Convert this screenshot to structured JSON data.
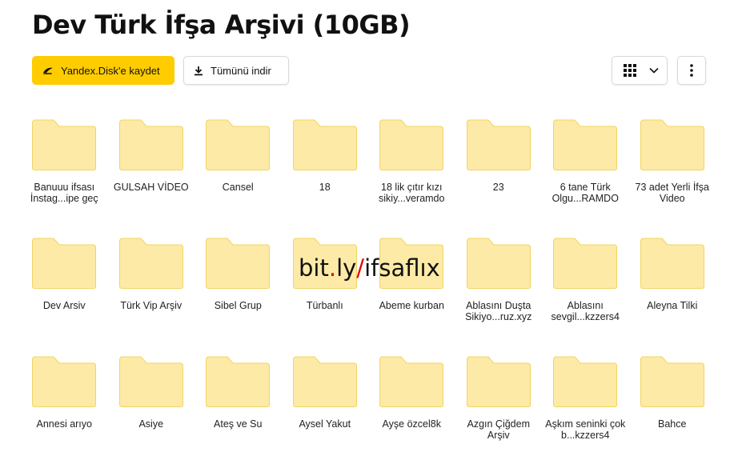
{
  "header": {
    "title": "Dev Türk İfşa Arşivi (10GB)"
  },
  "toolbar": {
    "save_label": "Yandex.Disk'e kaydet",
    "download_label": "Tümünü indir",
    "view_icon": "grid-icon",
    "more_icon": "more-vertical-icon"
  },
  "colors": {
    "accent": "#ffcc00",
    "folder_fill": "#fdeaa6",
    "folder_stroke": "#f2d462"
  },
  "watermark": {
    "part1": "bit",
    "dot": ".",
    "part2": "ly",
    "slash": "/",
    "part3": "ifsaflıx"
  },
  "folders": [
    {
      "name": "Banuuu ifsası İnstag...ipe geç"
    },
    {
      "name": "GULSAH VİDEO"
    },
    {
      "name": "Cansel"
    },
    {
      "name": "18"
    },
    {
      "name": "18 lik çıtır kızı sikiy...veramdo"
    },
    {
      "name": "23"
    },
    {
      "name": "6 tane Türk Olgu...RAMDO"
    },
    {
      "name": "73 adet Yerli İfşa Video"
    },
    {
      "name": "Dev Arsiv"
    },
    {
      "name": "Türk Vip Arşiv"
    },
    {
      "name": "Sibel Grup"
    },
    {
      "name": "Türbanlı"
    },
    {
      "name": "Abeme kurban"
    },
    {
      "name": "Ablasını Duşta Sikiyo...ruz.xyz"
    },
    {
      "name": "Ablasını sevgil...kzzers4"
    },
    {
      "name": "Aleyna Tilki"
    },
    {
      "name": "Annesi arıyo"
    },
    {
      "name": "Asiye"
    },
    {
      "name": "Ateş ve Su"
    },
    {
      "name": "Aysel Yakut"
    },
    {
      "name": "Ayşe özcel8k"
    },
    {
      "name": "Azgın Çiğdem Arşiv"
    },
    {
      "name": "Aşkım seninki çok b...kzzers4"
    },
    {
      "name": "Bahce"
    }
  ]
}
